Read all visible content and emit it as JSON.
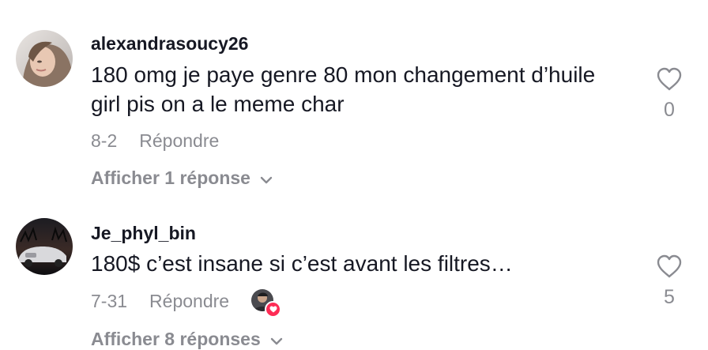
{
  "comments": [
    {
      "username": "alexandrasoucy26",
      "text": "180 omg je paye genre 80 mon changement d’huile girl pis on a le meme char",
      "date": "8-2",
      "reply_label": "Répondre",
      "view_replies": "Afficher 1 réponse",
      "like_count": "0"
    },
    {
      "username": "Je_phyl_bin",
      "text": "180$ c’est insane si c’est avant les filtres…",
      "date": "7-31",
      "reply_label": "Répondre",
      "view_replies": "Afficher 8 réponses",
      "like_count": "5"
    }
  ],
  "icons": {
    "like": "heart-outline-icon",
    "expand": "chevron-down-icon",
    "creator_liked": "red-heart-badge-icon"
  },
  "colors": {
    "primary_text": "#161823",
    "secondary_text": "#8a8b91",
    "accent": "#fe2c55"
  }
}
